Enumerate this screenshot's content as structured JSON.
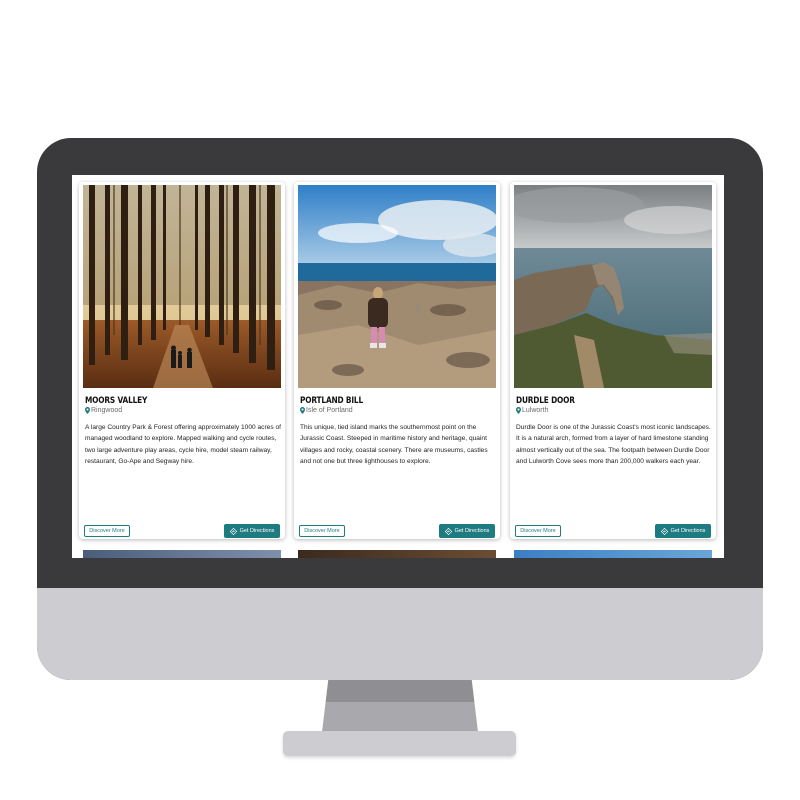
{
  "cards": [
    {
      "title": "MOORS VALLEY",
      "location": "Ringwood",
      "description": "A large Country Park & Forest offering approximately 1000 acres of managed woodland to explore. Mapped walking and cycle routes, two large adventure play areas, cycle hire, model steam railway, restaurant, Go-Ape and Segway hire.",
      "discover_label": "Discover More",
      "directions_label": "Get Directions"
    },
    {
      "title": "PORTLAND BILL",
      "location": "Isle of Portland",
      "description": "This unique, tied island marks the southernmost point on the Jurassic Coast. Steeped in maritime history and heritage, quaint villages and rocky, coastal scenery. There are museums, castles and not one but three lighthouses to explore.",
      "discover_label": "Discover More",
      "directions_label": "Get Directions"
    },
    {
      "title": "DURDLE DOOR",
      "location": "Lulworth",
      "description": "Durdle Door is one of the Jurassic Coast's most iconic landscapes. It is a natural arch, formed from a layer of hard limestone standing almost vertically out of the sea. The footpath between Durdle Door and Lulworth Cove sees more than 200,000 walkers each year.",
      "discover_label": "Discover More",
      "directions_label": "Get Directions"
    }
  ],
  "colors": {
    "accent": "#1f7b82",
    "bezel": "#3a3a3d",
    "chin": "#cdcdd1"
  },
  "icons": {
    "location": "map-pin-icon",
    "directions": "directions-icon"
  }
}
